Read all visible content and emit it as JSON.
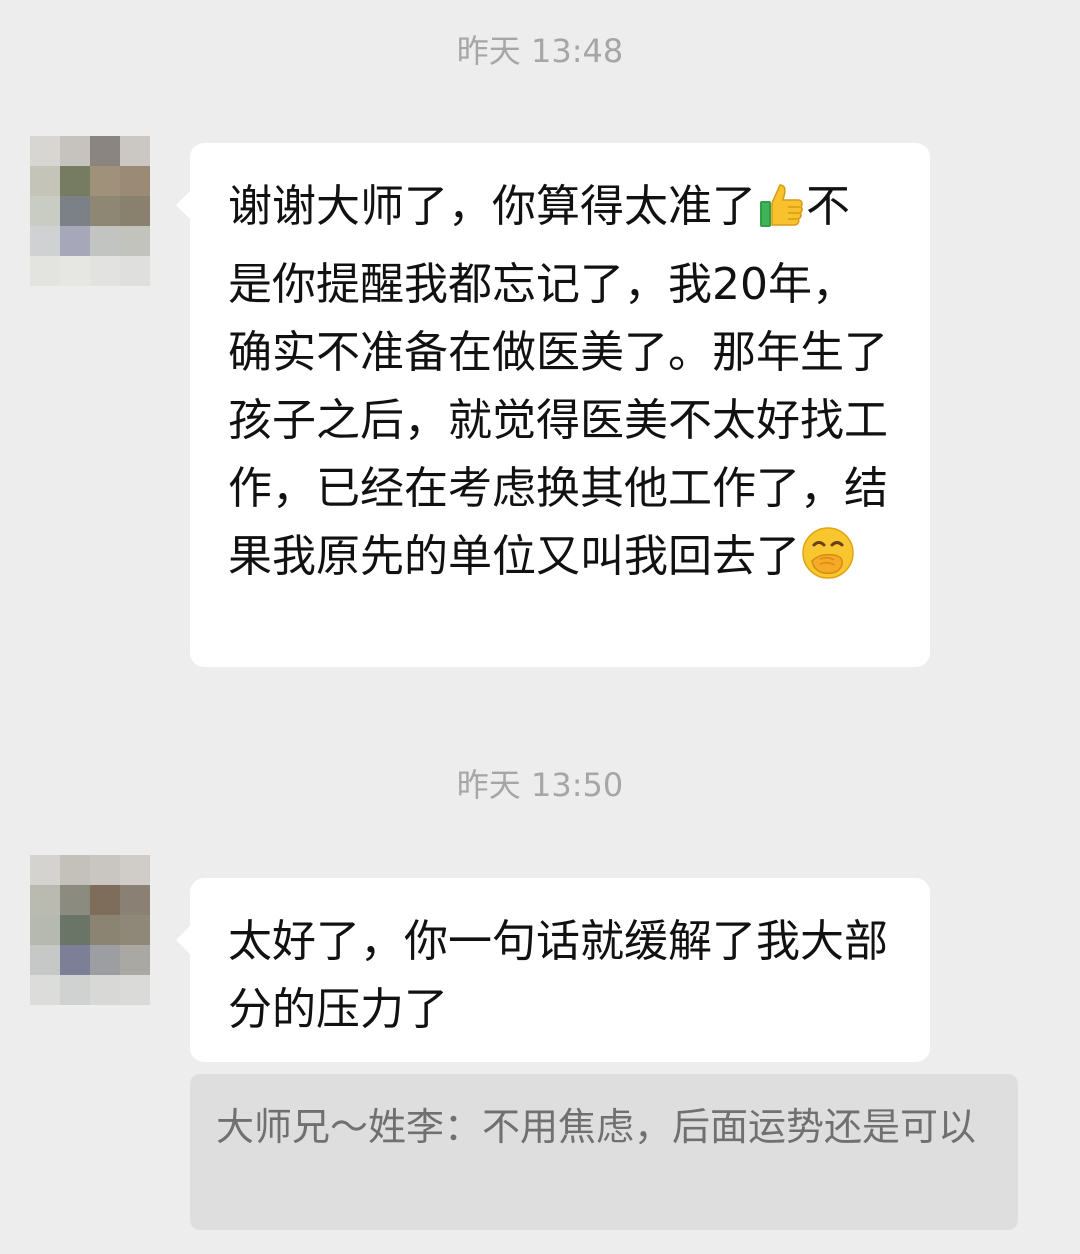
{
  "chat": {
    "messages": [
      {
        "timestamp": "昨天 13:48",
        "text_part1": "谢谢大师了，你算得太准了",
        "emoji1": "thumbs-up-icon",
        "text_part2": "不是你提醒我都忘记了，我20年，确实不准备在做医美了。那年生了孩子之后，就觉得医美不太好找工作，已经在考虑换其他工作了，结果我原先的单位又叫我回去了",
        "emoji2": "hand-over-mouth-face-icon"
      },
      {
        "timestamp": "昨天 13:50",
        "text": "太好了，你一句话就缓解了我大部分的压力了",
        "quote": "大师兄～姓李：不用焦虑，后面运势还是可以"
      }
    ]
  },
  "colors": {
    "background": "#ededed",
    "bubble": "#ffffff",
    "quote_background": "#dedede",
    "timestamp_text": "#a6a6a6"
  }
}
